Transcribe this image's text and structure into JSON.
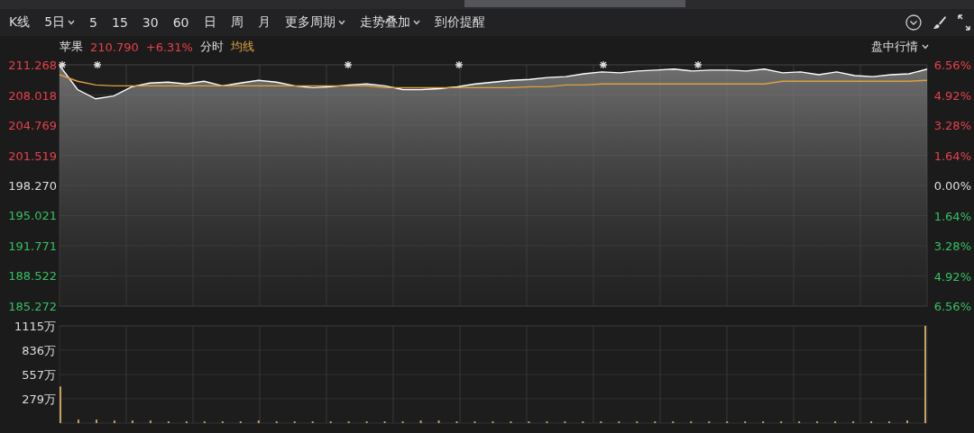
{
  "toolbar": {
    "items": [
      {
        "label": "K线",
        "dropdown": false
      },
      {
        "label": "5日",
        "dropdown": true
      },
      {
        "label": "5",
        "dropdown": false
      },
      {
        "label": "15",
        "dropdown": false
      },
      {
        "label": "30",
        "dropdown": false
      },
      {
        "label": "60",
        "dropdown": false
      },
      {
        "label": "日",
        "dropdown": false
      },
      {
        "label": "周",
        "dropdown": false
      },
      {
        "label": "月",
        "dropdown": false
      },
      {
        "label": "更多周期",
        "dropdown": true
      },
      {
        "label": "走势叠加",
        "dropdown": true
      },
      {
        "label": "到价提醒",
        "dropdown": false
      }
    ]
  },
  "quote": {
    "name": "苹果",
    "price": "210.790",
    "change": "+6.31%",
    "mode": "分时",
    "menu": "盘中行情"
  },
  "price_chart": {
    "chart_data": {
      "type": "line",
      "grid": true,
      "ylim": [
        185.272,
        211.268
      ],
      "y2lim": [
        -6.56,
        6.56
      ],
      "yticks": [
        {
          "value": 211.268,
          "label": "211.268"
        },
        {
          "value": 208.018,
          "label": "208.018"
        },
        {
          "value": 204.769,
          "label": "204.769"
        },
        {
          "value": 201.519,
          "label": "201.519"
        },
        {
          "value": 198.27,
          "label": "198.270"
        },
        {
          "value": 195.021,
          "label": "195.021"
        },
        {
          "value": 191.771,
          "label": "191.771"
        },
        {
          "value": 188.522,
          "label": "188.522"
        },
        {
          "value": 185.272,
          "label": "185.272"
        }
      ],
      "y2ticks": [
        {
          "value": 6.56,
          "label": "6.56%"
        },
        {
          "value": 4.92,
          "label": "4.92%"
        },
        {
          "value": 3.28,
          "label": "3.28%"
        },
        {
          "value": 1.64,
          "label": "1.64%"
        },
        {
          "value": 0,
          "label": "0.00%"
        },
        {
          "value": -1.64,
          "label": "1.64%"
        },
        {
          "value": -3.28,
          "label": "3.28%"
        },
        {
          "value": -4.92,
          "label": "4.92%"
        },
        {
          "value": -6.56,
          "label": "6.56%"
        }
      ],
      "series": [
        {
          "color": "#ffffff",
          "values": [
            211.2,
            208.6,
            207.6,
            207.9,
            208.9,
            209.3,
            209.4,
            209.2,
            209.5,
            209.0,
            209.3,
            209.6,
            209.4,
            209.0,
            208.8,
            208.9,
            209.1,
            209.2,
            209.0,
            208.6,
            208.6,
            208.7,
            208.9,
            209.2,
            209.4,
            209.6,
            209.7,
            209.9,
            210.0,
            210.3,
            210.5,
            210.4,
            210.6,
            210.7,
            210.8,
            210.6,
            210.7,
            210.7,
            210.6,
            210.8,
            210.4,
            210.5,
            210.2,
            210.5,
            210.1,
            210.0,
            210.2,
            210.3,
            210.8
          ]
        },
        {
          "name": "均线",
          "color": "#e0a040",
          "values": [
            210.2,
            209.5,
            209.1,
            209.0,
            209.0,
            209.0,
            209.0,
            209.0,
            209.0,
            209.0,
            209.0,
            209.0,
            209.0,
            209.0,
            209.0,
            209.0,
            209.0,
            209.0,
            208.8,
            208.8,
            208.8,
            208.8,
            208.8,
            208.8,
            208.8,
            208.8,
            208.9,
            208.9,
            209.1,
            209.1,
            209.2,
            209.2,
            209.2,
            209.2,
            209.2,
            209.2,
            209.2,
            209.2,
            209.2,
            209.2,
            209.5,
            209.5,
            209.5,
            209.5,
            209.5,
            209.5,
            209.5,
            209.5,
            209.6
          ]
        }
      ]
    }
  },
  "volume_chart": {
    "chart_data": {
      "type": "bar",
      "grid": true,
      "ylim": [
        0,
        1115
      ],
      "yticks": [
        {
          "value": 1115,
          "label": "1115万"
        },
        {
          "value": 836,
          "label": "836万"
        },
        {
          "value": 557,
          "label": "557万"
        },
        {
          "value": 279,
          "label": "279万"
        }
      ],
      "series": [
        {
          "color": "#c8a060",
          "values": [
            420,
            40,
            40,
            30,
            30,
            30,
            20,
            20,
            20,
            20,
            20,
            30,
            20,
            20,
            20,
            20,
            20,
            20,
            20,
            20,
            30,
            30,
            20,
            20,
            20,
            20,
            20,
            20,
            20,
            20,
            20,
            20,
            20,
            20,
            20,
            20,
            20,
            20,
            20,
            20,
            20,
            20,
            20,
            20,
            20,
            20,
            20,
            30,
            1115
          ]
        }
      ]
    }
  }
}
